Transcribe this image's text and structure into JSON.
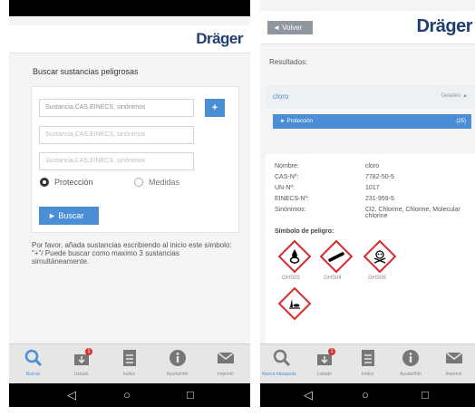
{
  "left": {
    "brand": "Dräger",
    "title": "Buscar sustancias peligrosas",
    "inputs": [
      {
        "placeholder": "Sustancia,CAS,EINECS, sinónimos"
      },
      {
        "placeholder": "Sustancia,CAS,EINECS, sinónimos"
      },
      {
        "placeholder": "Sustancia,CAS,EINECS, sinónimos"
      }
    ],
    "add_button": "+",
    "radio_protection": "Protección",
    "radio_measures": "Medidas",
    "search_button": "► Buscar",
    "hint": "Por favor, añada sustancias escribiendo al inicio este símbolo: \"+\"/ Puede buscar como maximo 3 sustancias simultáneamente."
  },
  "right": {
    "back_button": "◄ Volver",
    "brand": "Dräger",
    "results_label": "Resultados:",
    "result_name": "cloro",
    "details_label": "Detalles ▲",
    "protection_label": "► Protección",
    "protection_count": "(25)",
    "details": [
      {
        "key": "Nombre:",
        "value": "cloro"
      },
      {
        "key": "CAS-Nº:",
        "value": "7782-50-5"
      },
      {
        "key": "UN-Nº:",
        "value": "1017"
      },
      {
        "key": "EINECS-Nº:",
        "value": "231-959-5"
      },
      {
        "key": "Sinónimos:",
        "value": "Cl2, Chlorine, Chlorine, Molecular chlorine"
      }
    ],
    "hazard_label": "Símbolo de peligro:",
    "hazards": [
      "GHS03",
      "GHS04",
      "GHS06",
      ""
    ]
  },
  "tabs_left": [
    "Buscar",
    "Listado",
    "Índice",
    "Ayuda/Info",
    "Imprimir"
  ],
  "tabs_right": [
    "Nueva búsqueda",
    "Listado",
    "Índice",
    "Ayuda/Info",
    "Imprimir"
  ],
  "badge_count": "1",
  "colors": {
    "accent": "#4a8fd6",
    "brand": "#1f3f6f",
    "hazard": "#d92b2b",
    "badge": "#d9342b"
  }
}
